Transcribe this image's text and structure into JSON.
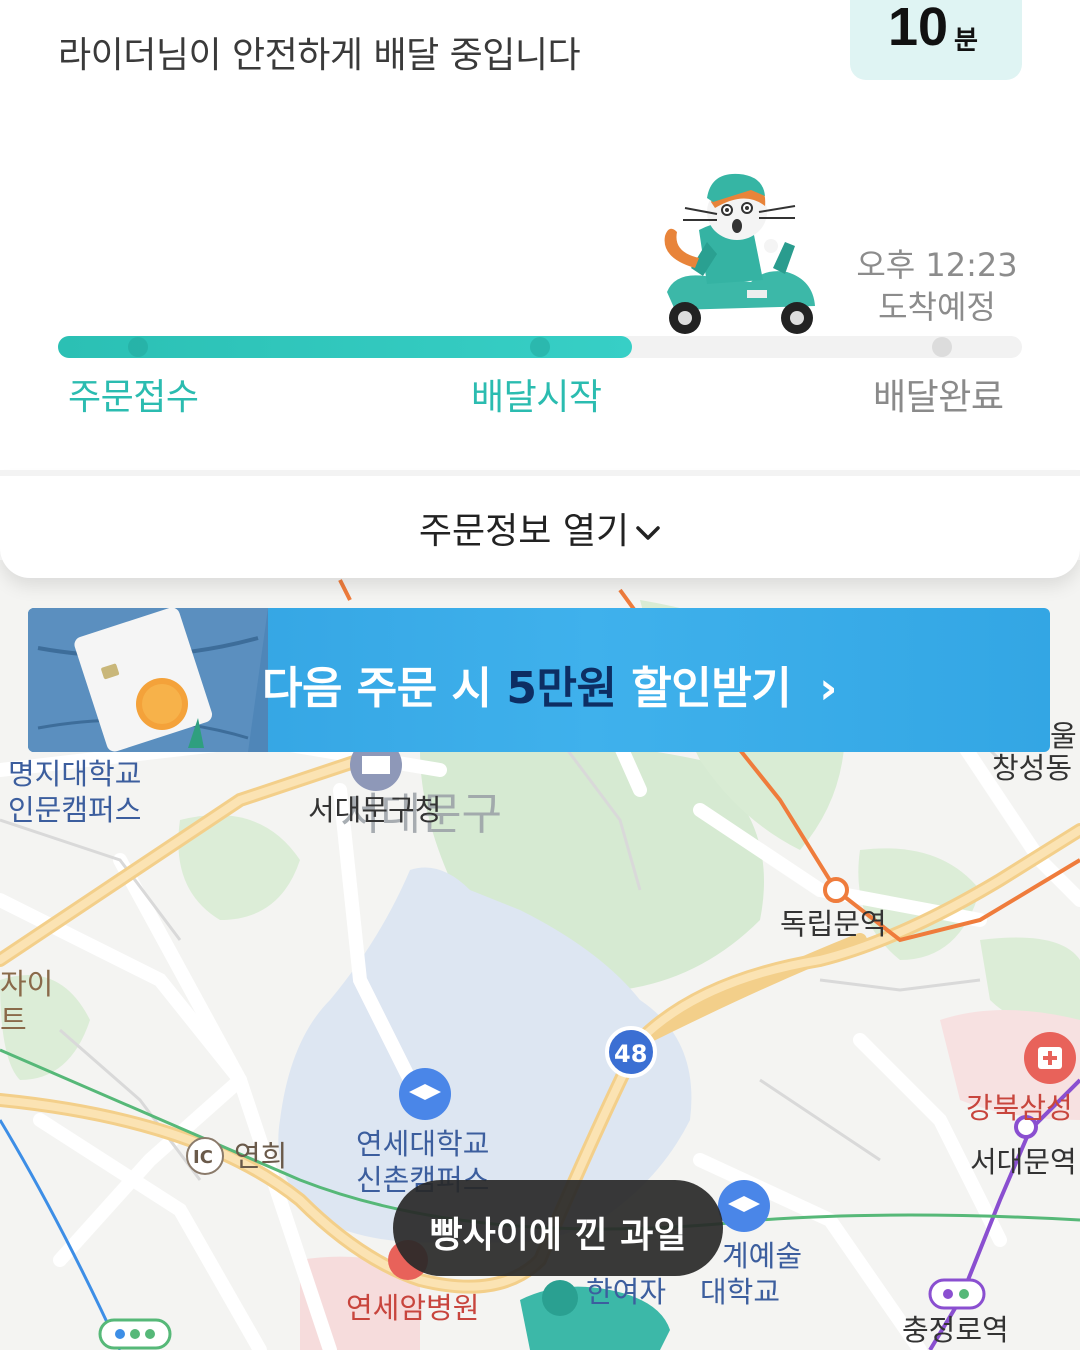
{
  "header": {
    "status_message": "라이더님이 안전하게 배달 중입니다",
    "eta_minutes": "10",
    "eta_unit": "분",
    "arrival_time": "오후 12:23",
    "arrival_label": "도착예정"
  },
  "progress": {
    "fraction": 0.595,
    "steps": [
      {
        "label": "주문접수",
        "state": "done"
      },
      {
        "label": "배달시작",
        "state": "done"
      },
      {
        "label": "배달완료",
        "state": "pending"
      }
    ]
  },
  "order_info": {
    "toggle_label": "주문정보 열기"
  },
  "banner": {
    "text_before": "다음 주문 시 ",
    "highlight": "5만원",
    "text_after": " 할인받기",
    "arrow": "›"
  },
  "map": {
    "labels": {
      "myongji_1": "명지대학교",
      "myongji_2": "인문캠퍼스",
      "seodaemun_office": "서대문구청",
      "district": "서대문구",
      "dongnimmun": "독립문역",
      "partial_left_1": "자이",
      "partial_left_2": "트",
      "yeonhui": "연희",
      "ic": "IC",
      "yonsei_1": "연세대학교",
      "yonsei_2": "신촌캠퍼스",
      "route_48": "48",
      "gangbuk": "강북삼성",
      "seodaemun_stn": "서대문역",
      "yonsei_cancer": "연세암병원",
      "womens": "한여자",
      "arts_1": "계예술",
      "arts_2": "대학교",
      "chungjeongno": "충정로역",
      "right_top_1": "울",
      "right_top_2": "창성동"
    }
  },
  "toast": {
    "message": "빵사이에 낀 과일"
  },
  "colors": {
    "accent": "#2bbcb0",
    "banner_blue": "#3aaae8",
    "hospital_red": "#e8625a"
  }
}
